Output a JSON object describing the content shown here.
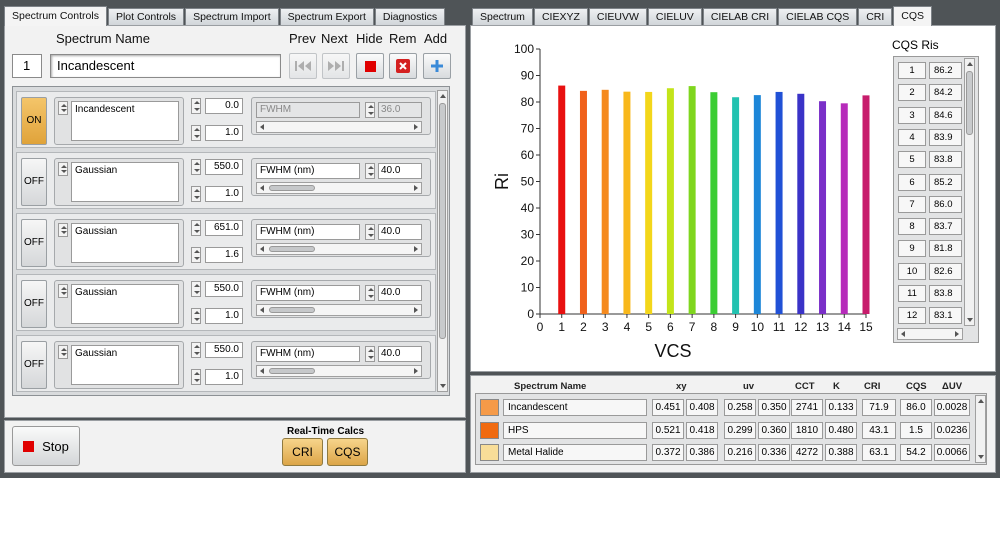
{
  "left_tabs": [
    "Spectrum Controls",
    "Plot Controls",
    "Spectrum Import",
    "Spectrum Export",
    "Diagnostics"
  ],
  "right_tabs": [
    "Spectrum",
    "CIEXYZ",
    "CIEUVW",
    "CIELUV",
    "CIELAB CRI",
    "CIELAB CQS",
    "CRI",
    "CQS"
  ],
  "header": {
    "spectrum_name_label": "Spectrum Name",
    "index": "1",
    "spectrum_name": "Incandescent",
    "prev": "Prev",
    "next": "Next",
    "hide": "Hide",
    "rem": "Rem",
    "add": "Add"
  },
  "spectra": [
    {
      "state": "ON",
      "type": "Incandescent",
      "value1": "0.0",
      "value2": "1.0",
      "fwhm_label": "FWHM",
      "fwhm": "36.0",
      "disabled": true
    },
    {
      "state": "OFF",
      "type": "Gaussian",
      "value1": "550.0",
      "value2": "1.0",
      "fwhm_label": "FWHM (nm)",
      "fwhm": "40.0",
      "disabled": false
    },
    {
      "state": "OFF",
      "type": "Gaussian",
      "value1": "651.0",
      "value2": "1.6",
      "fwhm_label": "FWHM (nm)",
      "fwhm": "40.0",
      "disabled": false
    },
    {
      "state": "OFF",
      "type": "Gaussian",
      "value1": "550.0",
      "value2": "1.0",
      "fwhm_label": "FWHM (nm)",
      "fwhm": "40.0",
      "disabled": false
    },
    {
      "state": "OFF",
      "type": "Gaussian",
      "value1": "550.0",
      "value2": "1.0",
      "fwhm_label": "FWHM (nm)",
      "fwhm": "40.0",
      "disabled": false
    }
  ],
  "controls": {
    "stop": "Stop",
    "realtime_label": "Real-Time Calcs",
    "cri": "CRI",
    "cqs": "CQS"
  },
  "cqs_ris": {
    "title": "CQS Ris",
    "rows": [
      {
        "i": "1",
        "v": "86.2"
      },
      {
        "i": "2",
        "v": "84.2"
      },
      {
        "i": "3",
        "v": "84.6"
      },
      {
        "i": "4",
        "v": "83.9"
      },
      {
        "i": "5",
        "v": "83.8"
      },
      {
        "i": "6",
        "v": "85.2"
      },
      {
        "i": "7",
        "v": "86.0"
      },
      {
        "i": "8",
        "v": "83.7"
      },
      {
        "i": "9",
        "v": "81.8"
      },
      {
        "i": "10",
        "v": "82.6"
      },
      {
        "i": "11",
        "v": "83.8"
      },
      {
        "i": "12",
        "v": "83.1"
      }
    ]
  },
  "results": {
    "headers": {
      "name": "Spectrum Name",
      "xy": "xy",
      "uv": "uv",
      "cct": "CCT",
      "k": "K",
      "cri": "CRI",
      "cqs": "CQS",
      "duv": "ΔUV"
    },
    "rows": [
      {
        "color": "#f59a48",
        "name": "Incandescent",
        "x": "0.451",
        "y": "0.408",
        "u": "0.258",
        "v": "0.350",
        "cct": "2741",
        "k": "0.133",
        "cri": "71.9",
        "cqs": "86.0",
        "duv": "0.0028"
      },
      {
        "color": "#f06a10",
        "name": "HPS",
        "x": "0.521",
        "y": "0.418",
        "u": "0.299",
        "v": "0.360",
        "cct": "1810",
        "k": "0.480",
        "cri": "43.1",
        "cqs": "1.5",
        "duv": "0.0236"
      },
      {
        "color": "#f8dd98",
        "name": "Metal Halide",
        "x": "0.372",
        "y": "0.386",
        "u": "0.216",
        "v": "0.336",
        "cct": "4272",
        "k": "0.388",
        "cri": "63.1",
        "cqs": "54.2",
        "duv": "0.0066"
      }
    ]
  },
  "chart_data": {
    "type": "bar",
    "xlabel": "VCS",
    "ylabel": "Ri",
    "ylim": [
      0,
      100
    ],
    "xlim": [
      0,
      15
    ],
    "yticks": [
      "0",
      "10",
      "20",
      "30",
      "40",
      "50",
      "60",
      "70",
      "80",
      "90",
      "100"
    ],
    "xticks": [
      "0",
      "1",
      "2",
      "3",
      "4",
      "5",
      "6",
      "7",
      "8",
      "9",
      "10",
      "11",
      "12",
      "13",
      "14",
      "15"
    ],
    "categories": [
      "1",
      "2",
      "3",
      "4",
      "5",
      "6",
      "7",
      "8",
      "9",
      "10",
      "11",
      "12",
      "13",
      "14",
      "15"
    ],
    "values": [
      86.2,
      84.2,
      84.6,
      83.9,
      83.8,
      85.2,
      86.0,
      83.7,
      81.8,
      82.6,
      83.8,
      83.1,
      80.3,
      79.5,
      82.5
    ],
    "colors": [
      "#e81010",
      "#f0611b",
      "#f58a1e",
      "#f8b81c",
      "#f3d61a",
      "#c3e41a",
      "#7fd61e",
      "#3bcd33",
      "#22c2b0",
      "#1d86d8",
      "#2151d6",
      "#3a33c7",
      "#7a2fc8",
      "#b62bba",
      "#c71c6c"
    ],
    "grid": false
  }
}
